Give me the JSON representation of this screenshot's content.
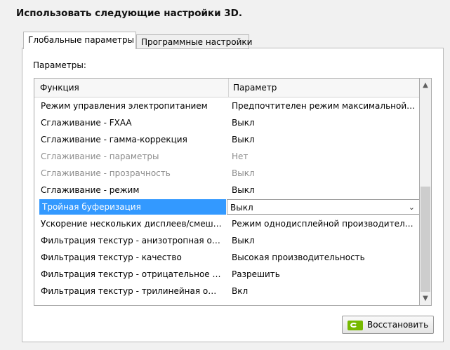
{
  "heading": "Использовать следующие настройки 3D.",
  "tabs": [
    {
      "label": "Глобальные параметры",
      "active": true
    },
    {
      "label": "Программные настройки",
      "active": false
    }
  ],
  "params_label": "Параметры:",
  "grid": {
    "columns": [
      "Функция",
      "Параметр"
    ],
    "rows": [
      {
        "feature": "Режим управления электропитанием",
        "value": "Предпочтителен режим максимальной п...",
        "state": "normal"
      },
      {
        "feature": "Сглаживание - FXAA",
        "value": "Выкл",
        "state": "normal"
      },
      {
        "feature": "Сглаживание - гамма-коррекция",
        "value": "Выкл",
        "state": "normal"
      },
      {
        "feature": "Сглаживание - параметры",
        "value": "Нет",
        "state": "disabled"
      },
      {
        "feature": "Сглаживание - прозрачность",
        "value": "Выкл",
        "state": "disabled"
      },
      {
        "feature": "Сглаживание - режим",
        "value": "Выкл",
        "state": "normal"
      },
      {
        "feature": "Тройная буферизация",
        "value": "Выкл",
        "state": "selected"
      },
      {
        "feature": "Ускорение нескольких дисплеев/смеша...",
        "value": "Режим однодисплейной производитель...",
        "state": "normal"
      },
      {
        "feature": "Фильтрация текстур - анизотропная оп...",
        "value": "Выкл",
        "state": "normal"
      },
      {
        "feature": "Фильтрация текстур - качество",
        "value": "Высокая производительность",
        "state": "normal"
      },
      {
        "feature": "Фильтрация текстур - отрицательное о...",
        "value": "Разрешить",
        "state": "normal"
      },
      {
        "feature": "Фильтрация текстур - трилинейная опт...",
        "value": "Вкл",
        "state": "normal"
      }
    ]
  },
  "restore_button": {
    "label": "Восстановить",
    "icon": "nvidia-logo-icon"
  },
  "colors": {
    "selection": "#3399ff",
    "nvidia_green": "#76b900"
  }
}
